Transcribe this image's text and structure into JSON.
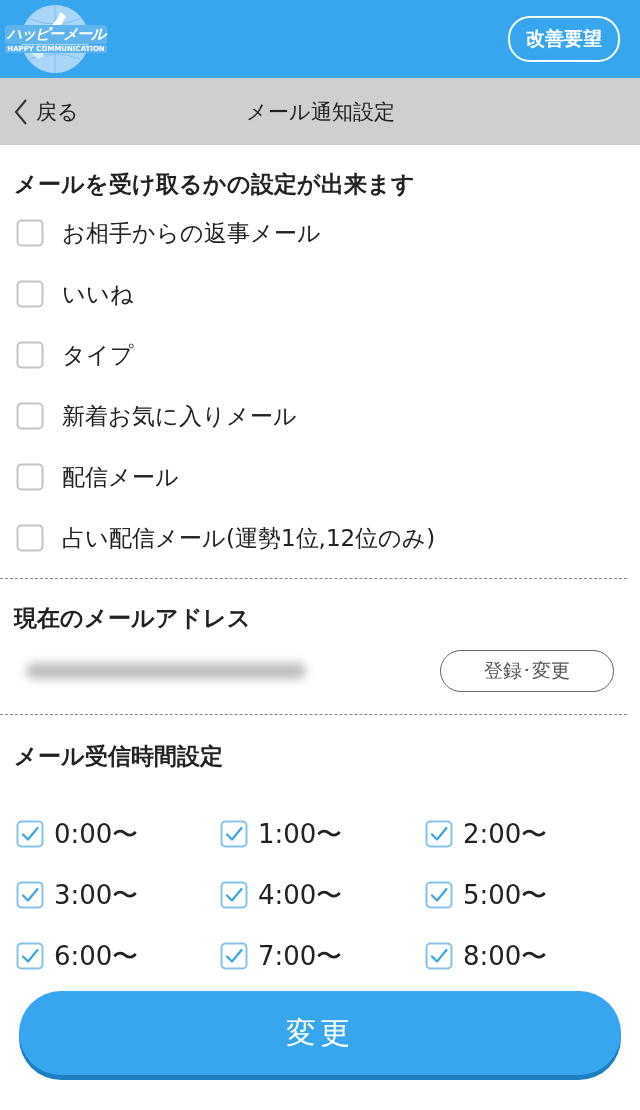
{
  "header": {
    "logo_title": "ハッピーメール",
    "logo_subtitle": "HAPPY COMMUNICATION",
    "request_button": "改善要望"
  },
  "nav": {
    "back": "戻る",
    "title": "メール通知設定"
  },
  "notifications": {
    "heading": "メールを受け取るかの設定が出来ます",
    "items": [
      {
        "label": "お相手からの返事メール",
        "checked": false
      },
      {
        "label": "いいね",
        "checked": false
      },
      {
        "label": "タイプ",
        "checked": false
      },
      {
        "label": "新着お気に入りメール",
        "checked": false
      },
      {
        "label": "配信メール",
        "checked": false
      },
      {
        "label": "占い配信メール(運勢1位,12位のみ)",
        "checked": false
      }
    ]
  },
  "address": {
    "heading": "現在のメールアドレス",
    "button": "登録･変更"
  },
  "hours": {
    "heading": "メール受信時間設定",
    "slots": [
      {
        "label": "0:00〜",
        "checked": true
      },
      {
        "label": "1:00〜",
        "checked": true
      },
      {
        "label": "2:00〜",
        "checked": true
      },
      {
        "label": "3:00〜",
        "checked": true
      },
      {
        "label": "4:00〜",
        "checked": true
      },
      {
        "label": "5:00〜",
        "checked": true
      },
      {
        "label": "6:00〜",
        "checked": true
      },
      {
        "label": "7:00〜",
        "checked": true
      },
      {
        "label": "8:00〜",
        "checked": true
      }
    ]
  },
  "submit_button": "変更"
}
